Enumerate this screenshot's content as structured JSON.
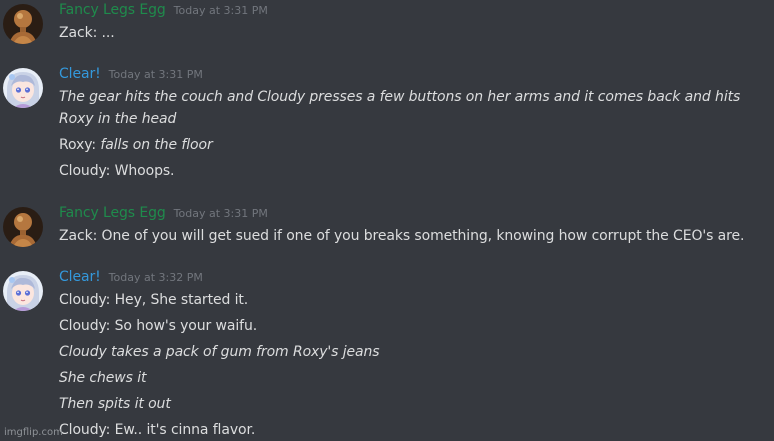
{
  "colors": {
    "background": "#36393f",
    "fancy_name": "#1f8b4c",
    "clear_name": "#3498db",
    "message_text": "#dcddde",
    "timestamp": "#72767d"
  },
  "groups": [
    {
      "author": "Fancy Legs Egg",
      "timestamp": "Today at 3:31 PM",
      "avatar": "wooden-mannequin-avatar",
      "lines": [
        {
          "prefix": "Zack: ...",
          "italic": ""
        }
      ]
    },
    {
      "author": "Clear!",
      "timestamp": "Today at 3:31 PM",
      "avatar": "anime-girl-avatar",
      "lines": [
        {
          "prefix": "",
          "italic": "The gear hits the couch and Cloudy presses a few buttons on her arms and it comes back and hits"
        },
        {
          "prefix": "",
          "italic": "Roxy in the head"
        },
        {
          "prefix": "Roxy: ",
          "italic": "falls on the floor"
        },
        {
          "prefix": "Cloudy: Whoops.",
          "italic": ""
        }
      ]
    },
    {
      "author": "Fancy Legs Egg",
      "timestamp": "Today at 3:31 PM",
      "avatar": "wooden-mannequin-avatar",
      "lines": [
        {
          "prefix": "Zack: One of you will get sued if one of you breaks something, knowing how corrupt the CEO's are.",
          "italic": ""
        }
      ]
    },
    {
      "author": "Clear!",
      "timestamp": "Today at 3:32 PM",
      "avatar": "anime-girl-avatar",
      "lines": [
        {
          "prefix": "Cloudy: Hey, She started it.",
          "italic": ""
        },
        {
          "prefix": "Cloudy: So how's your waifu.",
          "italic": ""
        },
        {
          "prefix": "",
          "italic": "Cloudy takes a pack of gum from Roxy's jeans"
        },
        {
          "prefix": "",
          "italic": "She chews it"
        },
        {
          "prefix": "",
          "italic": "Then spits it out"
        },
        {
          "prefix": "Cloudy: Ew.. it's cinna flavor.",
          "italic": ""
        }
      ]
    }
  ],
  "watermark": "imgflip.com"
}
